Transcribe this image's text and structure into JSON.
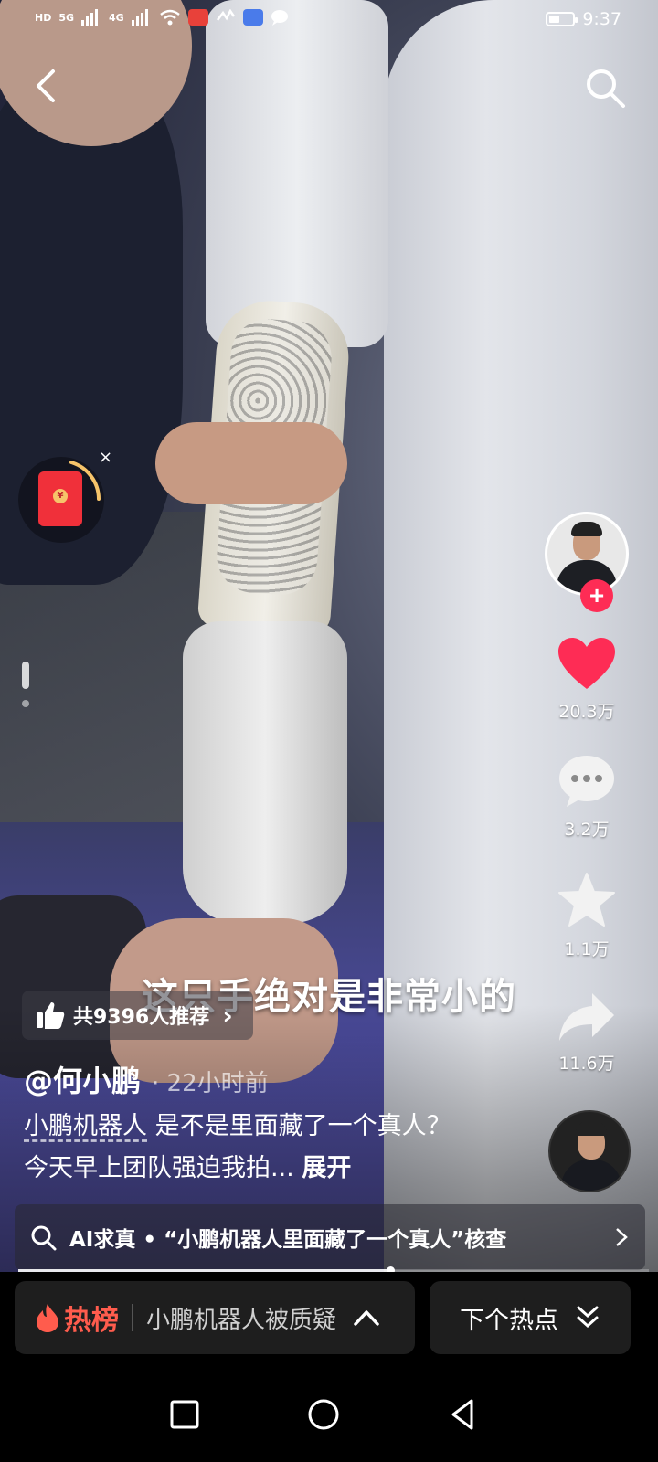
{
  "status_bar": {
    "left_labels": [
      "HD",
      "5G",
      "4G"
    ],
    "time": "9:37",
    "battery_level": 0.45
  },
  "video": {
    "subtitle": "这只手绝对是非常小的"
  },
  "red_packet": {
    "coin_symbol": "¥",
    "close_symbol": "×"
  },
  "rail": {
    "likes": "20.3万",
    "comments": "3.2万",
    "favorites": "1.1万",
    "shares": "11.6万",
    "follow_symbol": "+"
  },
  "recommend": {
    "label": "共9396人推荐",
    "chevron": "›"
  },
  "author": {
    "name": "@何小鹏",
    "time": "· 22小时前"
  },
  "description": {
    "tag": "小鹏机器人",
    "text": " 是不是里面藏了一个真人？今天早上团队强迫我拍... ",
    "expand": "展开"
  },
  "ai_bar": {
    "text": "AI求真 • “小鹏机器人里面藏了一个真人”核查"
  },
  "progress": {
    "value": 0.59
  },
  "hot": {
    "label": "热榜",
    "topic": "小鹏机器人被质疑",
    "next_label": "下个热点"
  },
  "colors": {
    "like": "#fe2c55",
    "hot": "#ff5c4d",
    "follow": "#fe2c55"
  }
}
